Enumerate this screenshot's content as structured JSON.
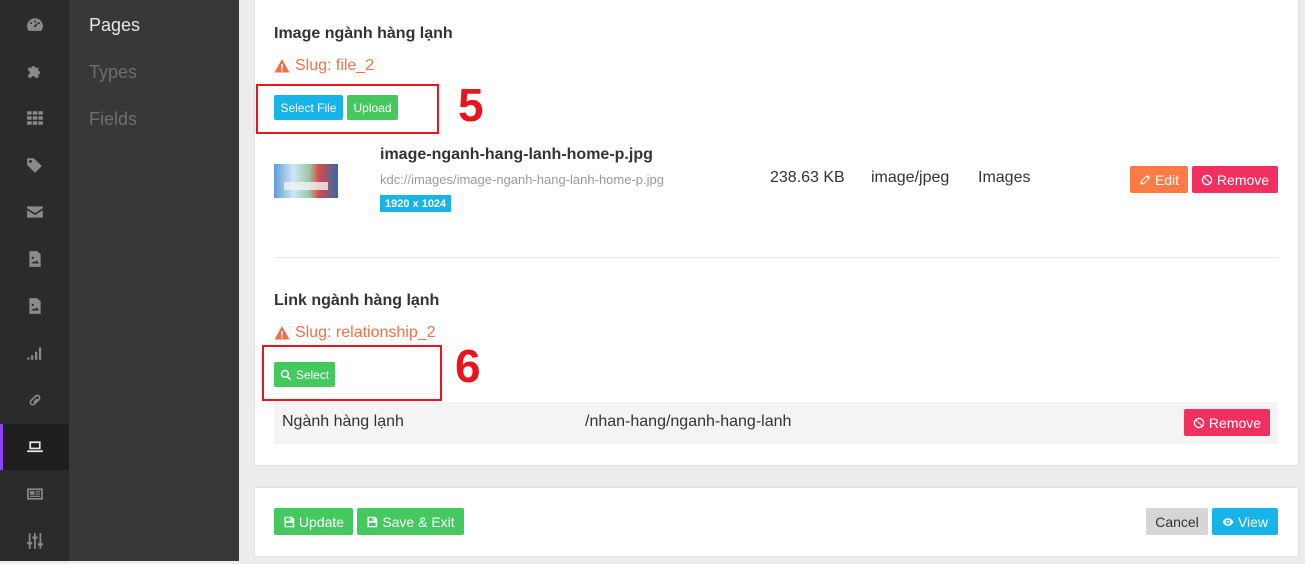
{
  "rail": {
    "icons": [
      "dashboard-icon",
      "puzzle-icon",
      "grid-icon",
      "tag-icon",
      "envelope-icon",
      "file-image-icon",
      "file-image-icon-2",
      "signal-icon",
      "link-icon",
      "laptop-icon",
      "newspaper-icon",
      "sliders-icon"
    ]
  },
  "subnav": {
    "items": [
      "Pages",
      "Types",
      "Fields"
    ]
  },
  "image_field": {
    "title": "Image ngành hàng lạnh",
    "slug": "Slug: file_2",
    "select_file": "Select File",
    "upload": "Upload",
    "file": {
      "name": "image-nganh-hang-lanh-home-p.jpg",
      "path": "kdc://images/image-nganh-hang-lanh-home-p.jpg",
      "dimensions": "1920 x 1024",
      "size": "238.63 KB",
      "mime": "image/jpeg",
      "folder": "Images",
      "edit": "Edit",
      "remove": "Remove"
    }
  },
  "link_field": {
    "title": "Link ngành hàng lạnh",
    "slug": "Slug: relationship_2",
    "select": "Select",
    "row": {
      "name": "Ngành hàng lạnh",
      "url": "/nhan-hang/nganh-hang-lanh",
      "remove": "Remove"
    }
  },
  "annotations": {
    "step5": "5",
    "step6": "6",
    "color": "#e6151f"
  },
  "footer": {
    "update": "Update",
    "save_exit": "Save & Exit",
    "cancel": "Cancel",
    "view": "View"
  },
  "colors": {
    "blue": "#17b4ea",
    "green": "#45c95f",
    "orange": "#ff7a45",
    "pink": "#f2305f",
    "slug": "#f07047",
    "accent": "#8e44ff"
  }
}
